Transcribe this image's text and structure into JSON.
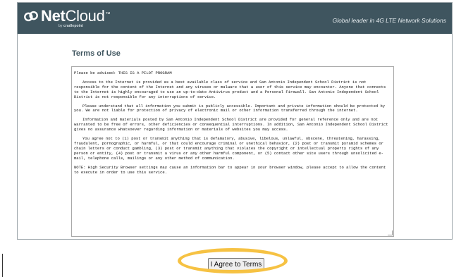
{
  "header": {
    "brand_net": "Net",
    "brand_cloud": "Cloud",
    "trademark": "™",
    "byline_prefix": "by",
    "byline_company": "cradlepoint",
    "tagline": "Global leader in 4G LTE Network Solutions",
    "background_color": "#3f555f",
    "logo_icon": "link-icon"
  },
  "terms": {
    "title": "Terms of Use",
    "paragraphs": [
      "Please be advised: THIS IS A PILOT PROGRAM",
      "Access to the Internet is provided as a best available class of service and San Antonio Independent School District is not responsible for the content of the Internet and any viruses or malware that a user of this service may encounter. Anyone that connects to the Internet is highly encouraged to use an up-to-date Antivirus product and a Personal Firewall.  San Antonio Independent School District is not responsible for any interruptions of service.",
      "Please understand that all information you submit is publicly accessible. Important and private information should be protected by you. We are not liable for protection of privacy of electronic mail or other information transferred through the internet.",
      "Information and materials posted by San Antonio Independent School District are provided for general reference only and are not warranted to be free of errors, other deficiencies or consequential interruptions. In addition, San Antonio Independent School District gives no assurance whatsoever regarding information or materials of websites you may access.",
      "You agree not to (1) post or transmit anything that is defamatory, abusive, libelous, unlawful, obscene, threatening, harassing, fraudulent, pornographic, or harmful, or that could encourage criminal or unethical behavior, (2) post or transmit pyramid schemes or chain letters or conduct gambling, (3) post or transmit anything that violates the copyright or intellectual property rights of any person or entity, (4) post or transmit a virus or any other harmful component, or (5) contact other site users through unsolicited e-mail, telephone calls, mailings or any other method of communication.",
      "NOTE: High Security Browser settings may cause an information bar to appear in your browser window, please accept to allow the content to execute in order to use this service."
    ]
  },
  "actions": {
    "agree_label": "I Agree to Terms",
    "highlight_color": "#f6c243"
  }
}
